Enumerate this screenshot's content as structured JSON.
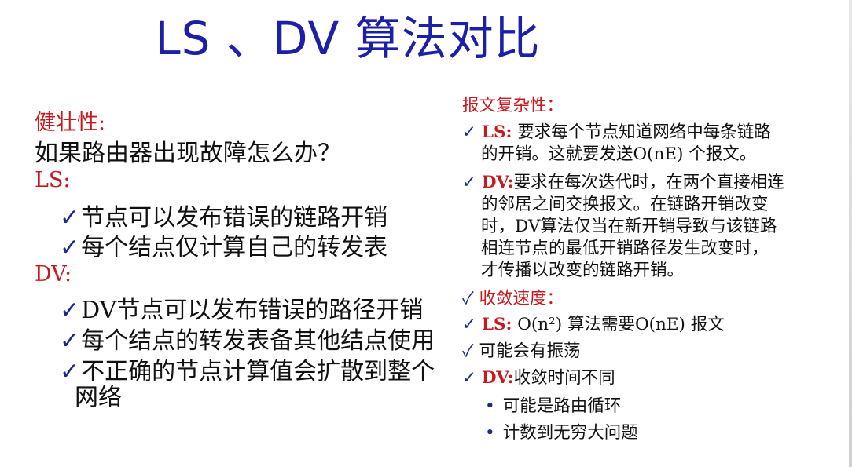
{
  "title": "LS 、DV 算法对比",
  "left": {
    "robustness_heading": "健壮性:",
    "question": "如果路由器出现故障怎么办？",
    "ls_label": "LS:",
    "ls_items": [
      "节点可以发布错误的链路开销",
      "每个结点仅计算自己的转发表"
    ],
    "dv_label": "DV:",
    "dv_items": [
      "DV节点可以发布错误的路径开销",
      "每个结点的转发表备其他结点使用",
      "不正确的节点计算值会扩散到整个"
    ],
    "dv_item3_cont": "网络"
  },
  "right": {
    "msg_heading": "报文复杂性：",
    "ls_label": "LS:",
    "ls_line1": " 要求每个节点知道网络中每条链路",
    "ls_line2": "的开销。这就要发送O(nE) 个报文。",
    "dv_label": "DV:",
    "dv_line1": "要求在每次迭代时，在两个直接相连",
    "dv_lines": [
      "的邻居之间交换报文。在链路开销改变",
      "时，DV算法仅当在新开销导致与该链路",
      "相连节点的最低开销路径发生改变时，",
      "才传播以改变的链路开销。"
    ],
    "conv_heading": "收敛速度：",
    "conv_ls_label": "LS:",
    "conv_ls_text": " O(n²) 算法需要O(nE) 报文",
    "oscillation": "可能会有振荡",
    "conv_dv_label": "DV:",
    "conv_dv_text": "收敛时间不同",
    "sub_bullets": [
      "可能是路由循环",
      "计数到无穷大问题"
    ]
  },
  "icons": {
    "check": "✓",
    "bullet": "•"
  },
  "colors": {
    "title": "#1c20a8",
    "heading": "#c8191e",
    "check": "#1a2a8a"
  }
}
